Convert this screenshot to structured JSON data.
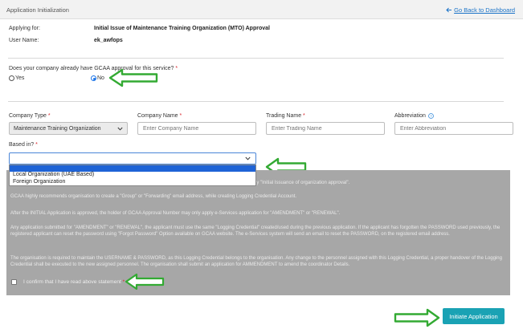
{
  "header": {
    "title": "Application Initialization",
    "back_link": "Go Back to Dashboard"
  },
  "info": {
    "applying_for_label": "Applying for:",
    "applying_for_value": "Initial Issue of Maintenance Training Organization (MTO) Approval",
    "user_name_label": "User Name:",
    "user_name_value": "ek_awfops"
  },
  "approval_question": {
    "label": "Does your company already have GCAA approval for this service?",
    "required_mark": "*",
    "options": [
      "Yes",
      "No"
    ],
    "selected": "No"
  },
  "fields": {
    "company_type": {
      "label": "Company Type",
      "value": "Maintenance Training Organization"
    },
    "company_name": {
      "label": "Company Name",
      "placeholder": "Enter Company Name"
    },
    "trading_name": {
      "label": "Trading Name",
      "placeholder": "Enter Trading Name"
    },
    "abbreviation": {
      "label": "Abbreviation",
      "placeholder": "Enter Abbreviation"
    },
    "required_mark": "*"
  },
  "based_in": {
    "label": "Based in?",
    "required_mark": "*",
    "options": [
      "Local Organization (UAE Based)",
      "Foreign Organization"
    ]
  },
  "notice": {
    "paragraphs": [
      "ly \"Initial Issuance of organization approval\".",
      "GCAA highly recommends organisation to create a \"Group\" or \"Forwarding\" email address, while creating Logging Credential Account.",
      "After the INITIAL Application is approved, the holder of GCAA Approval Number may only apply e-Services application for \"AMENDMENT\" or \"RENEWAL\".",
      "Any application submitted for \"AMENDMENT\" or \"RENEWAL\", the applicant must use the same \"Logging Credential\" created/used during the previous application. If the applicant has forgotten the PASSWORD used previously, the registered applicant can reset the password using \"Forgot Password\" Option available on GCAA website. The e-Services system will send an email to reset the PASSWORD, on the registered email address.",
      "The organisation is required to maintain the USERNAME & PASSWORD, as this Logging Credential belongs to the organisation. Any change to the personnel assigned with this Logging Credential, a proper handover of the Logging Credential shall be executed to the new assigned personnel. The organisation shall submit an application for AMMENDMENT to amend the coordinator Details."
    ],
    "confirm_label": "I confirm that I have read above statement",
    "confirm_required_mark": "*"
  },
  "submit_button": "Initiate Application",
  "colors": {
    "accent_button": "#1aa2b4",
    "link": "#1a73c8",
    "arrow": "#33aa33",
    "required": "#d9262c",
    "dropdown_highlight": "#1e63d6"
  }
}
